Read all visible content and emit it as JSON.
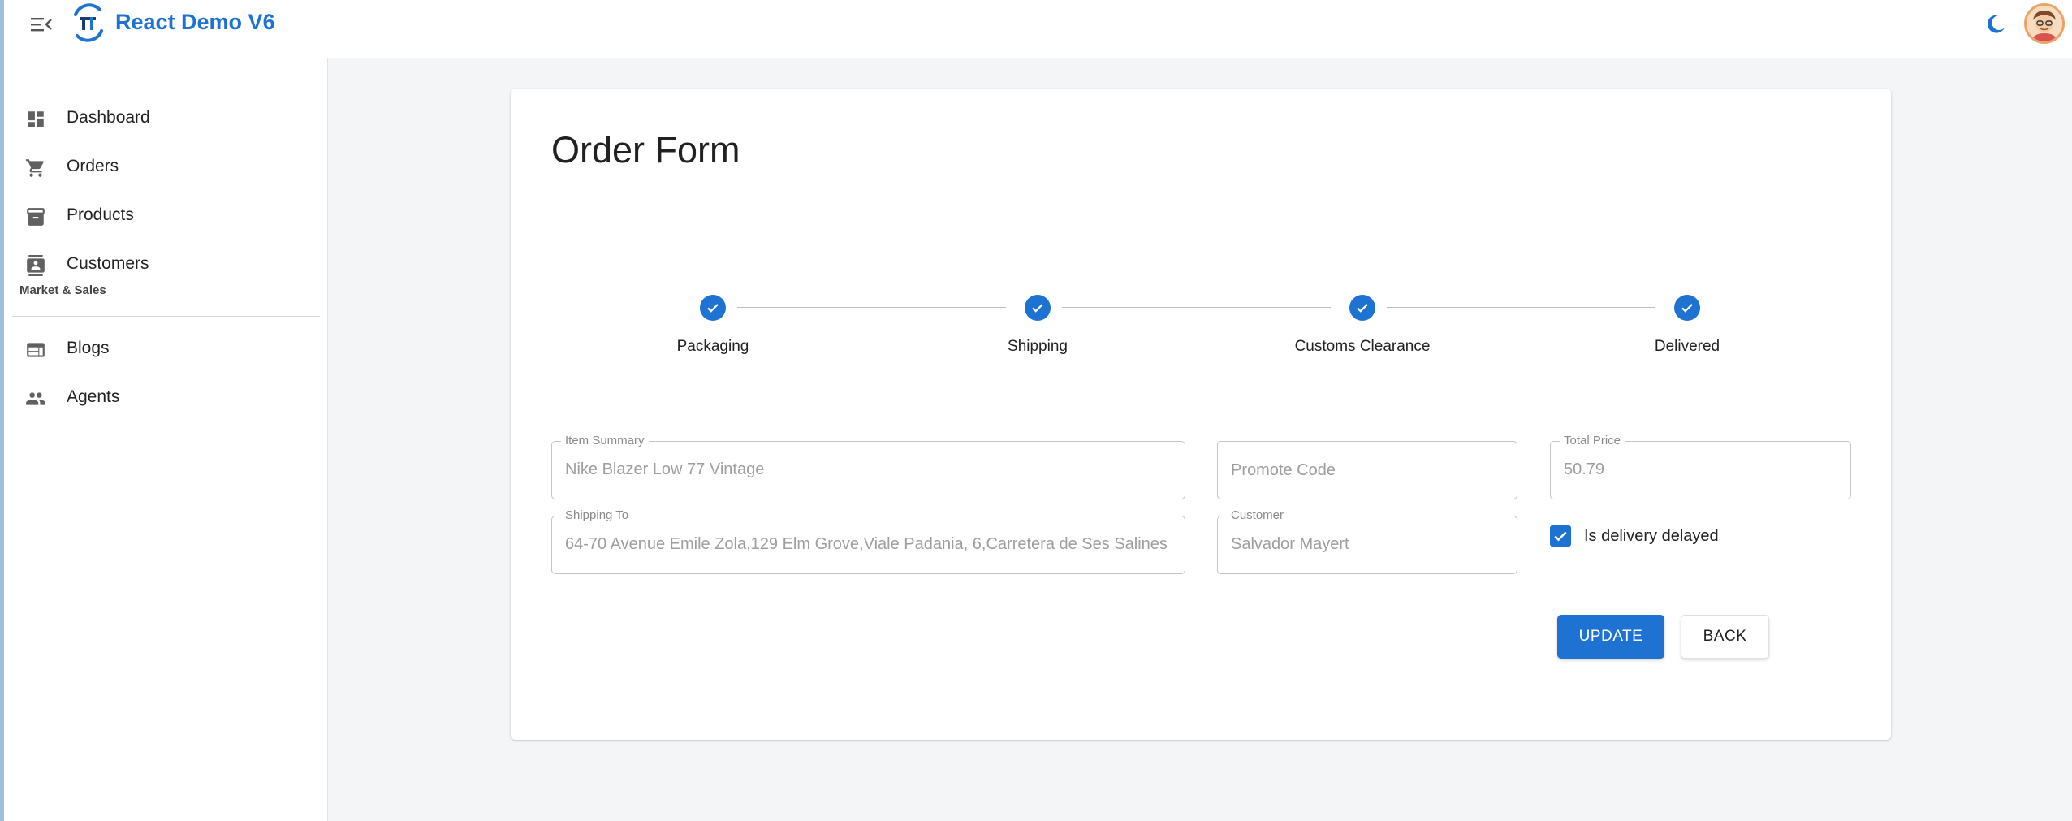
{
  "app": {
    "title": "React Demo V6",
    "accent_color": "#1e73d2"
  },
  "header": {
    "menu_icon": "menu-collapse-icon",
    "theme_icon": "moon-icon",
    "avatar_icon": "user-avatar"
  },
  "sidebar": {
    "items": [
      {
        "label": "Dashboard",
        "icon": "dashboard-icon"
      },
      {
        "label": "Orders",
        "icon": "cart-icon"
      },
      {
        "label": "Products",
        "icon": "archive-icon"
      },
      {
        "label": "Customers",
        "icon": "contact-card-icon"
      }
    ],
    "section_label": "Market & Sales",
    "section_items": [
      {
        "label": "Blogs",
        "icon": "web-layout-icon"
      },
      {
        "label": "Agents",
        "icon": "people-icon"
      }
    ]
  },
  "form": {
    "title": "Order Form",
    "steps": [
      {
        "label": "Packaging",
        "status": "completed"
      },
      {
        "label": "Shipping",
        "status": "completed"
      },
      {
        "label": "Customs Clearance",
        "status": "completed"
      },
      {
        "label": "Delivered",
        "status": "completed"
      }
    ],
    "item_summary": {
      "label": "Item Summary",
      "value": "Nike Blazer Low 77 Vintage"
    },
    "promote_code": {
      "placeholder": "Promote Code",
      "value": ""
    },
    "total_price": {
      "label": "Total Price",
      "value": "50.79"
    },
    "shipping_to": {
      "label": "Shipping To",
      "value": "64-70 Avenue Emile Zola,129 Elm Grove,Viale Padania, 6,Carretera de Ses Salines"
    },
    "customer": {
      "label": "Customer",
      "value": "Salvador Mayert"
    },
    "delivery_delayed": {
      "label": "Is delivery delayed",
      "checked": true
    },
    "update_label": "UPDATE",
    "back_label": "BACK"
  }
}
